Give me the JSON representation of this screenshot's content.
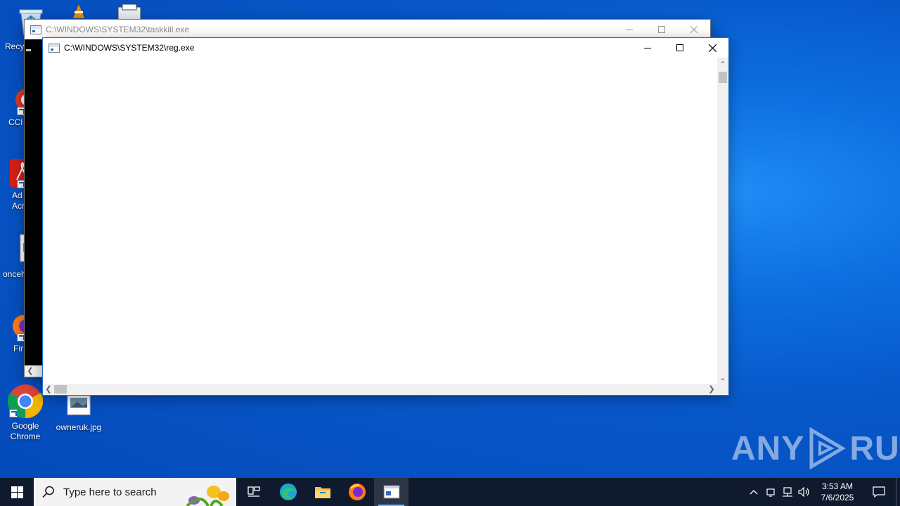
{
  "desktop": {
    "icons": [
      {
        "label": "Recy",
        "icon": "recycle-bin-icon"
      },
      {
        "label": "CCl",
        "icon": "ccleaner-icon"
      },
      {
        "label": "Ad Acr",
        "icon": "acrobat-icon"
      },
      {
        "label": "onceh",
        "icon": "image-file-icon"
      },
      {
        "label": "Fir",
        "icon": "firefox-icon"
      },
      {
        "label": "Google Chrome",
        "icon": "chrome-icon"
      },
      {
        "label": "owneruk.jpg",
        "icon": "image-file-icon"
      }
    ]
  },
  "windows": {
    "back": {
      "title": "C:\\WINDOWS\\SYSTEM32\\taskkill.exe",
      "state": "inactive"
    },
    "front": {
      "title": "C:\\WINDOWS\\SYSTEM32\\reg.exe",
      "state": "active"
    }
  },
  "watermark": {
    "left": "ANY",
    "right": "RUN"
  },
  "taskbar": {
    "search_placeholder": "Type here to search",
    "pinned": [
      "task-view-icon",
      "edge-icon",
      "file-explorer-icon",
      "firefox-icon",
      "console-icon"
    ],
    "clock_time": "3:53 AM",
    "clock_date": "7/6/2025"
  }
}
